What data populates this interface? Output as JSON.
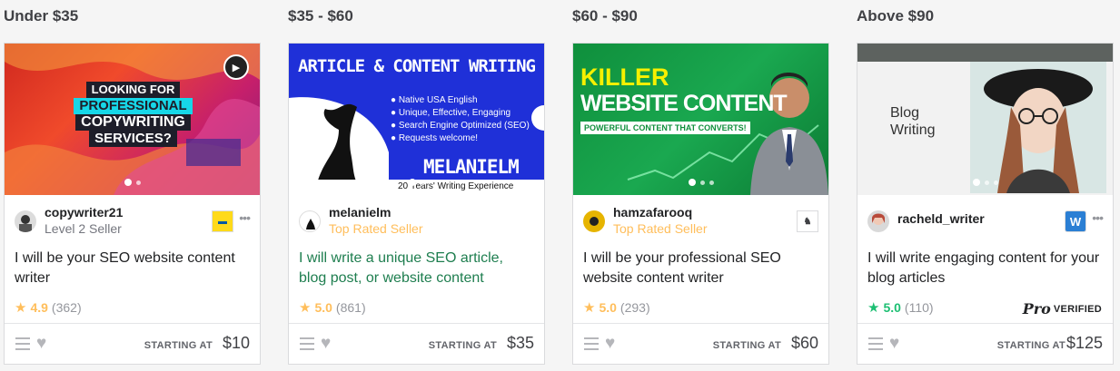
{
  "columns": [
    {
      "title": "Under $35",
      "thumb_text": [
        "LOOKING FOR",
        "PROFESSIONAL",
        "COPYWRITING",
        "SERVICES?"
      ],
      "seller_name": "copywriter21",
      "seller_level": "Level 2 Seller",
      "gig_title": "I will be your SEO website content writer",
      "rating": "4.9",
      "rating_count": "(362)",
      "starting_label": "STARTING AT",
      "price": "$10"
    },
    {
      "title": "$35 - $60",
      "thumb_text": [
        "ARTICLE & CONTENT WRITING",
        "Native USA English",
        "Unique, Effective, Engaging",
        "Search Engine Optimized (SEO)",
        "Requests welcome!",
        "MELANIELM",
        "20 Years' Writing Experience"
      ],
      "seller_name": "melanielm",
      "seller_level": "Top Rated Seller",
      "gig_title": "I will write a unique SEO article, blog post, or website content",
      "rating": "5.0",
      "rating_count": "(861)",
      "starting_label": "STARTING AT",
      "price": "$35"
    },
    {
      "title": "$60 - $90",
      "thumb_text": [
        "KILLER",
        "WEBSITE CONTENT",
        "POWERFUL CONTENT THAT CONVERTS!"
      ],
      "seller_name": "hamzafarooq",
      "seller_level": "Top Rated Seller",
      "gig_title": "I will be your professional SEO website content writer",
      "rating": "5.0",
      "rating_count": "(293)",
      "starting_label": "STARTING AT",
      "price": "$60"
    },
    {
      "title": "Above $90",
      "thumb_text": [
        "Blog",
        "Writing"
      ],
      "seller_name": "racheld_writer",
      "gig_title": "I will write engaging content for your blog articles",
      "rating": "5.0",
      "rating_count": "(110)",
      "pro_logo": "Pro",
      "pro_verified": "VERIFIED",
      "starting_label": "STARTING AT",
      "price": "$125"
    }
  ],
  "colors": {
    "gold": "#ffbe5b",
    "green": "#1dbf73",
    "title_green": "#1e7e4f"
  },
  "icons": [
    "play-icon",
    "menu-icon",
    "heart-icon",
    "star-icon",
    "more-icon"
  ]
}
